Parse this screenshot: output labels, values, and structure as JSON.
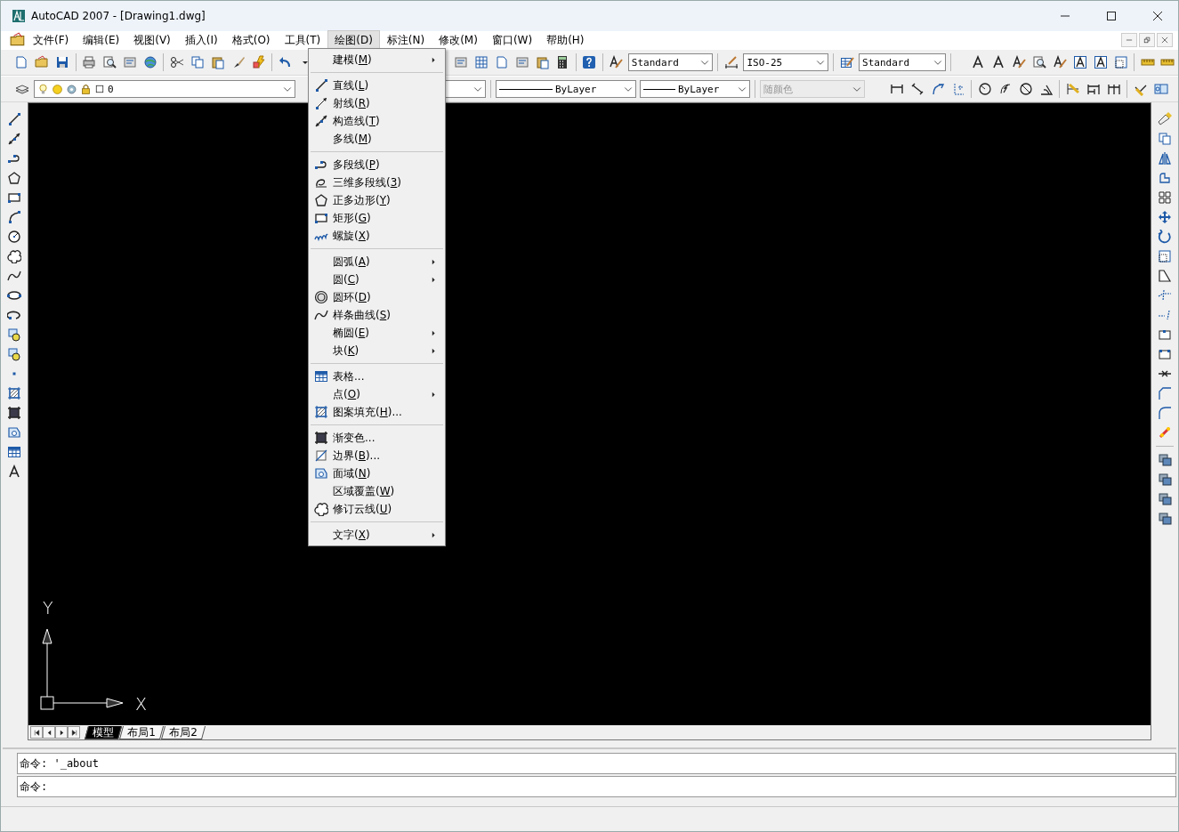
{
  "window": {
    "title": "AutoCAD 2007 - [Drawing1.dwg]"
  },
  "menu_bar": [
    {
      "label": "文件(F)",
      "selected": false
    },
    {
      "label": "编辑(E)",
      "selected": false
    },
    {
      "label": "视图(V)",
      "selected": false
    },
    {
      "label": "插入(I)",
      "selected": false
    },
    {
      "label": "格式(O)",
      "selected": false
    },
    {
      "label": "工具(T)",
      "selected": false
    },
    {
      "label": "绘图(D)",
      "selected": true
    },
    {
      "label": "标注(N)",
      "selected": false
    },
    {
      "label": "修改(M)",
      "selected": false
    },
    {
      "label": "窗口(W)",
      "selected": false
    },
    {
      "label": "帮助(H)",
      "selected": false
    }
  ],
  "styles_toolbar": {
    "text_style": "Standard",
    "dim_style": "ISO-25",
    "table_style": "Standard"
  },
  "layer_toolbar": {
    "layer": "0",
    "linetype": "ByLayer",
    "lineweight": "ByLayer",
    "plot_style": {
      "value": "随颜色",
      "disabled": true
    }
  },
  "draw_menu": {
    "groups": [
      [
        {
          "label": "建模(M)",
          "submenu": true
        }
      ],
      [
        {
          "label": "直线(L)",
          "submenu": false
        },
        {
          "label": "射线(R)",
          "submenu": false
        },
        {
          "label": "构造线(T)",
          "submenu": false
        },
        {
          "label": "多线(M)",
          "submenu": false
        }
      ],
      [
        {
          "label": "多段线(P)",
          "submenu": false
        },
        {
          "label": "三维多段线(3)",
          "submenu": false
        },
        {
          "label": "正多边形(Y)",
          "submenu": false
        },
        {
          "label": "矩形(G)",
          "submenu": false
        },
        {
          "label": "螺旋(X)",
          "submenu": false
        }
      ],
      [
        {
          "label": "圆弧(A)",
          "submenu": true
        },
        {
          "label": "圆(C)",
          "submenu": true
        },
        {
          "label": "圆环(D)",
          "submenu": false
        },
        {
          "label": "样条曲线(S)",
          "submenu": false
        },
        {
          "label": "椭圆(E)",
          "submenu": true
        },
        {
          "label": "块(K)",
          "submenu": true
        }
      ],
      [
        {
          "label": "表格...",
          "submenu": false
        },
        {
          "label": "点(O)",
          "submenu": true
        },
        {
          "label": "图案填充(H)...",
          "submenu": false
        }
      ],
      [
        {
          "label": "渐变色...",
          "submenu": false
        },
        {
          "label": "边界(B)...",
          "submenu": false
        },
        {
          "label": "面域(N)",
          "submenu": false
        },
        {
          "label": "区域覆盖(W)",
          "submenu": false
        },
        {
          "label": "修订云线(U)",
          "submenu": false
        }
      ],
      [
        {
          "label": "文字(X)",
          "submenu": true
        }
      ]
    ]
  },
  "ucs": {
    "x": "X",
    "y": "Y"
  },
  "layout_tabs": [
    {
      "label": "模型",
      "selected": true
    },
    {
      "label": "布局1",
      "selected": false
    },
    {
      "label": "布局2",
      "selected": false
    }
  ],
  "command_lines": [
    "命令: '_about",
    "命令:"
  ]
}
